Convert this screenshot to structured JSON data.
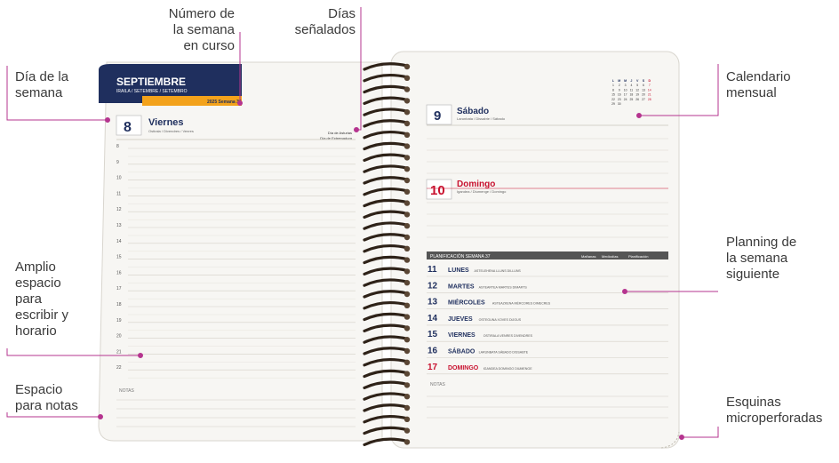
{
  "annotations": {
    "week_number": [
      "Número de",
      "la semana",
      "en curso"
    ],
    "marked_days": [
      "Días",
      "señalados"
    ],
    "weekday": [
      "Día de la",
      "semana"
    ],
    "monthly_calendar": [
      "Calendario",
      "mensual"
    ],
    "writing_space": [
      "Amplio",
      "espacio",
      "para",
      "escribir y",
      "horario"
    ],
    "next_week_planning": [
      "Planning de",
      "la semana",
      "siguiente"
    ],
    "notes_space": [
      "Espacio",
      "para notas"
    ],
    "perforated_corners": [
      "Esquinas",
      "microperforadas"
    ]
  },
  "left_page": {
    "month": "SEPTIEMBRE",
    "month_sub": "IRAILA / SETEMBRE / SETEMBRO",
    "year_week": "2025 Semana 36",
    "day_number": "8",
    "day_name": "Viernes",
    "day_translations": "Ostirala / Divendres / Venres",
    "marked_day_1": "Día de Asturias",
    "marked_day_2": "Día de Extremadura",
    "hours": [
      "8",
      "9",
      "10",
      "11",
      "12",
      "13",
      "14",
      "15",
      "16",
      "17",
      "18",
      "19",
      "20",
      "21",
      "22"
    ],
    "notes_label": "NOTAS"
  },
  "right_page": {
    "calendar_header": [
      "L",
      "M",
      "M",
      "J",
      "V",
      "S",
      "D"
    ],
    "calendar_rows": [
      [
        "",
        "",
        "",
        "",
        "",
        "",
        ""
      ],
      [
        "1",
        "2",
        "3",
        "4",
        "5",
        "6",
        "7"
      ],
      [
        "8",
        "9",
        "10",
        "11",
        "12",
        "13",
        "14"
      ],
      [
        "15",
        "16",
        "17",
        "18",
        "19",
        "20",
        "21"
      ],
      [
        "22",
        "23",
        "24",
        "25",
        "26",
        "27",
        "28"
      ],
      [
        "29",
        "30",
        "",
        "",
        "",
        "",
        ""
      ]
    ],
    "sat_number": "9",
    "sat_name": "Sábado",
    "sat_translations": "Larunbata / Dissabte / Sábado",
    "sun_number": "10",
    "sun_name": "Domingo",
    "sun_translations": "Igandea / Diumenge / Domingo",
    "planning_title": "PLANIFICACIÓN SEMANA 37",
    "planning_cols": [
      "Mañanas",
      "Mediodías",
      "Planificación"
    ],
    "planning_days": [
      {
        "num": "11",
        "name": "LUNES",
        "sub": "ASTELEHENA LLUNS DILLUNS",
        "color": "#1f2f5e"
      },
      {
        "num": "12",
        "name": "MARTES",
        "sub": "ASTEARTEA MARTES DIMARTS",
        "color": "#1f2f5e"
      },
      {
        "num": "13",
        "name": "MIÉRCOLES",
        "sub": "ASTEAZKENA MÉRCORES DIMECRES",
        "color": "#1f2f5e"
      },
      {
        "num": "14",
        "name": "JUEVES",
        "sub": "OSTEGUNA XOVES DIJOUS",
        "color": "#1f2f5e"
      },
      {
        "num": "15",
        "name": "VIERNES",
        "sub": "OSTIRALA VENRES DIVENDRES",
        "color": "#1f2f5e"
      },
      {
        "num": "16",
        "name": "SÁBADO",
        "sub": "LARUNBATA SÁBADO DISSABTE",
        "color": "#1f2f5e"
      },
      {
        "num": "17",
        "name": "DOMINGO",
        "sub": "IGANDEA DOMINGO DIUMENGE",
        "color": "#c8102e"
      }
    ],
    "notes_label": "NOTAS"
  },
  "colors": {
    "annotation_line": "#b5348f",
    "navy": "#1f2f5e",
    "orange": "#f3a21b",
    "red": "#c8102e",
    "spiral": "#3b2a1c"
  }
}
